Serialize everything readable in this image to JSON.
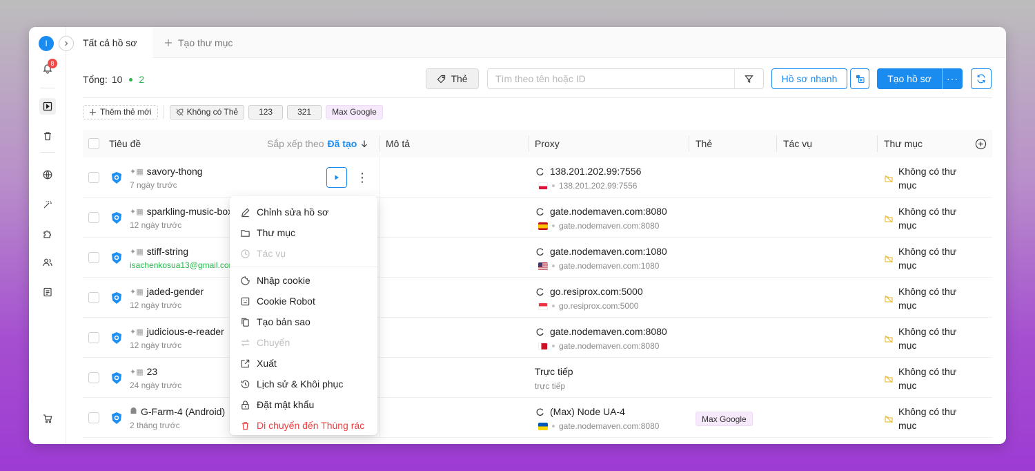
{
  "sidebar": {
    "avatar_letter": "I",
    "notification_count": "8"
  },
  "tabs": {
    "all_profiles": "Tất cả hồ sơ",
    "new_folder": "Tạo thư mục"
  },
  "toolbar": {
    "total_label": "Tổng:",
    "total_count": "10",
    "active_count": "2",
    "tag_button": "Thẻ",
    "search_placeholder": "Tìm theo tên hoặc ID",
    "quick_profile": "Hồ sơ nhanh",
    "create_profile": "Tạo hồ sơ",
    "create_more": "···"
  },
  "tags": {
    "add_new": "Thêm thẻ mới",
    "no_tag": "Không có Thẻ",
    "items": [
      "123",
      "321",
      "Max Google"
    ]
  },
  "table": {
    "headers": {
      "title": "Tiêu đề",
      "sort_label": "Sắp xếp theo",
      "sort_value": "Đã tạo",
      "description": "Mô tả",
      "proxy": "Proxy",
      "tag": "Thẻ",
      "task": "Tác vụ",
      "folder": "Thư mục"
    },
    "rows": [
      {
        "name": "savory-thong",
        "sub": "7 ngày trước",
        "proxy": "138.201.202.99:7556",
        "proxy_sub": "138.201.202.99:7556",
        "flag": "pl",
        "folder1": "Không có thư",
        "folder2": "mục",
        "tag": ""
      },
      {
        "name": "sparkling-music-box",
        "sub": "12 ngày trước",
        "proxy": "gate.nodemaven.com:8080",
        "proxy_sub": "gate.nodemaven.com:8080",
        "flag": "es",
        "folder1": "Không có thư",
        "folder2": "mục",
        "tag": ""
      },
      {
        "name": "stiff-string",
        "sub": "isachenkosua13@gmail.com",
        "proxy": "gate.nodemaven.com:1080",
        "proxy_sub": "gate.nodemaven.com:1080",
        "flag": "us",
        "folder1": "Không có thư",
        "folder2": "mục",
        "tag": ""
      },
      {
        "name": "jaded-gender",
        "sub": "12 ngày trước",
        "proxy": "go.resiprox.com:5000",
        "proxy_sub": "go.resiprox.com:5000",
        "flag": "sg",
        "folder1": "Không có thư",
        "folder2": "mục",
        "tag": ""
      },
      {
        "name": "judicious-e-reader",
        "sub": "12 ngày trước",
        "proxy": "gate.nodemaven.com:8080",
        "proxy_sub": "gate.nodemaven.com:8080",
        "flag": "bh",
        "folder1": "Không có thư",
        "folder2": "mục",
        "tag": ""
      },
      {
        "name": "23",
        "sub": "24 ngày trước",
        "proxy": "Trực tiếp",
        "proxy_sub": "trực tiếp",
        "flag": "",
        "folder1": "Không có thư",
        "folder2": "mục",
        "tag": ""
      },
      {
        "name": "G-Farm-4 (Android)",
        "sub": "2 tháng trước",
        "proxy": "(Max) Node UA-4",
        "proxy_sub": "gate.nodemaven.com:8080",
        "flag": "ua",
        "folder1": "Không có thư",
        "folder2": "mục",
        "tag": "Max Google"
      }
    ]
  },
  "context_menu": {
    "items": [
      "Chỉnh sửa hồ sơ",
      "Thư mục",
      "Tác vụ",
      "Nhập cookie",
      "Cookie Robot",
      "Tạo bản sao",
      "Chuyển",
      "Xuất",
      "Lịch sử & Khôi phục",
      "Đặt mật khẩu",
      "Di chuyển đến Thùng rác"
    ]
  },
  "colors": {
    "accent": "#1a8cf0",
    "danger": "#ef3d3d",
    "success": "#2ab54c"
  }
}
